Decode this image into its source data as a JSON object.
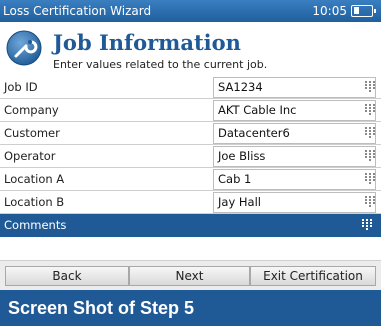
{
  "window": {
    "title": "Loss Certification Wizard",
    "clock": "10:05",
    "battery_level": 0.3
  },
  "header": {
    "title": "Job Information",
    "subtitle": "Enter values related to the current job.",
    "icon": "wrench-gear-icon"
  },
  "fields": [
    {
      "label": "Job ID",
      "value": "SA1234"
    },
    {
      "label": "Company",
      "value": "AKT Cable Inc"
    },
    {
      "label": "Customer",
      "value": "Datacenter6"
    },
    {
      "label": "Operator",
      "value": "Joe Bliss"
    },
    {
      "label": "Location A",
      "value": "Cab 1"
    },
    {
      "label": "Location B",
      "value": "Jay Hall"
    },
    {
      "label": "Comments",
      "value": ""
    }
  ],
  "buttons": {
    "back": "Back",
    "next": "Next",
    "exit": "Exit Certification"
  },
  "caption": "Screen Shot of Step 5",
  "colors": {
    "accent": "#1f5a96",
    "titlebar": "#2a6eae"
  }
}
